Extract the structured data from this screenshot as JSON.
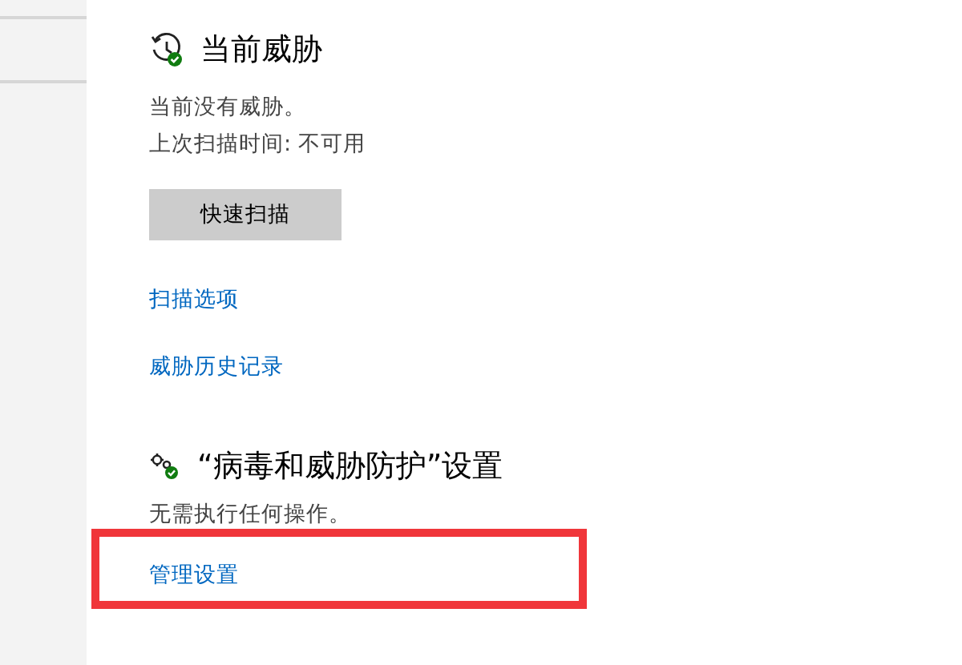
{
  "threats": {
    "title": "当前威胁",
    "lines": [
      "当前没有威胁。",
      "上次扫描时间: 不可用"
    ],
    "button": "快速扫描",
    "links": [
      "扫描选项",
      "威胁历史记录"
    ]
  },
  "settings": {
    "title": "“病毒和威胁防护”设置",
    "lines": [
      "无需执行任何操作。"
    ],
    "links": [
      "管理设置"
    ],
    "highlighted": true
  }
}
